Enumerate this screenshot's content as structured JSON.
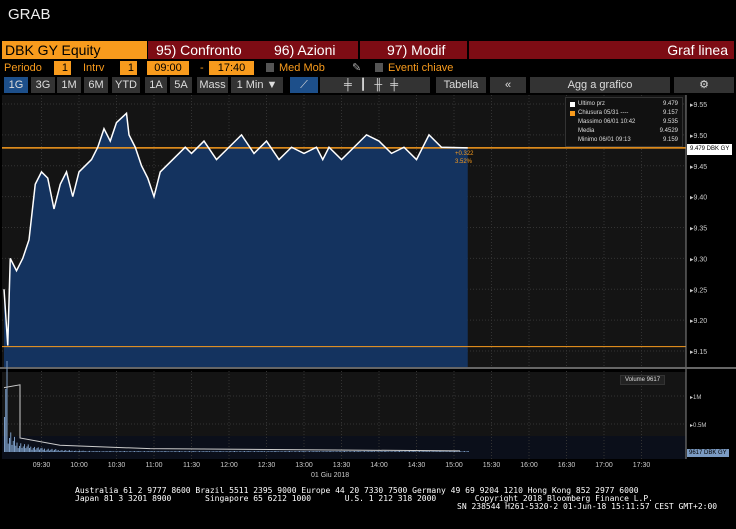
{
  "title": "GRAB",
  "header": {
    "ticker": "DBK GY Equity",
    "compare": "95) Confronto",
    "actions": "96) Azioni",
    "modify": "97) Modif",
    "chart_type": "Graf linea"
  },
  "controls": {
    "period_label": "Periodo",
    "period": "1",
    "interval_label": "Intrv",
    "interval": "1",
    "start": "09:00",
    "dash": "-",
    "end": "17:40",
    "moving_avg": "Med Mob",
    "key_events": "Eventi chiave"
  },
  "toolbar": {
    "ranges": [
      "1G",
      "3G",
      "1M",
      "6M",
      "YTD",
      "1A",
      "5A",
      "Mass"
    ],
    "freq": "1 Min ▼",
    "table": "Tabella",
    "back": "«",
    "add": "Agg a grafico",
    "settings": "⚙"
  },
  "legend": [
    {
      "label": "Ultimo prz",
      "value": "9.479"
    },
    {
      "label": "Chiusura 05/31 ----",
      "value": "9.157"
    },
    {
      "label": "Massimo 06/01 10:42",
      "value": "9.535"
    },
    {
      "label": "Media",
      "value": "9.4529"
    },
    {
      "label": "Minimo 06/01 09:13",
      "value": "9.159"
    }
  ],
  "change": {
    "abs": "+0.322",
    "pct": "3.52%"
  },
  "last_tag": "9.479 DBK GY",
  "volume": {
    "legend": "Volume 9617",
    "tag": "9617 DBK GY"
  },
  "date_label": "01 Giu 2018",
  "footer": {
    "line1": "Australia 61 2 9777 8600 Brazil 5511 2395 9000 Europe 44 20 7330 7500 Germany 49 69 9204 1210 Hong Kong 852 2977 6000",
    "line2": "Japan 81 3 3201 8900       Singapore 65 6212 1000       U.S. 1 212 318 2000        Copyright 2018 Bloomberg Finance L.P.",
    "line3": "SN 238544 H261-5320-2 01-Jun-18 15:11:57 CEST GMT+2:00"
  },
  "chart_data": {
    "type": "line",
    "ylim": [
      9.13,
      9.57
    ],
    "y_ticks": [
      "9.55",
      "9.50",
      "9.45",
      "9.40",
      "9.35",
      "9.30",
      "9.25",
      "9.20",
      "9.15"
    ],
    "x_ticks": [
      "09:30",
      "10:00",
      "10:30",
      "11:00",
      "11:30",
      "12:00",
      "12:30",
      "13:00",
      "13:30",
      "14:00",
      "14:30",
      "15:00",
      "15:30",
      "16:00",
      "16:30",
      "17:00",
      "17:30"
    ],
    "vol_ticks": [
      "1M",
      "0.5M"
    ],
    "prev_close": 9.157,
    "last": 9.479,
    "series": [
      [
        0,
        9.25
      ],
      [
        3,
        9.159
      ],
      [
        5,
        9.3
      ],
      [
        10,
        9.28
      ],
      [
        15,
        9.3
      ],
      [
        20,
        9.33
      ],
      [
        25,
        9.42
      ],
      [
        30,
        9.44
      ],
      [
        35,
        9.43
      ],
      [
        40,
        9.38
      ],
      [
        45,
        9.42
      ],
      [
        50,
        9.44
      ],
      [
        55,
        9.4
      ],
      [
        60,
        9.44
      ],
      [
        70,
        9.46
      ],
      [
        75,
        9.48
      ],
      [
        80,
        9.51
      ],
      [
        85,
        9.49
      ],
      [
        90,
        9.52
      ],
      [
        98,
        9.535
      ],
      [
        100,
        9.5
      ],
      [
        105,
        9.48
      ],
      [
        110,
        9.45
      ],
      [
        115,
        9.43
      ],
      [
        120,
        9.4
      ],
      [
        125,
        9.44
      ],
      [
        135,
        9.46
      ],
      [
        145,
        9.48
      ],
      [
        150,
        9.47
      ],
      [
        160,
        9.49
      ],
      [
        170,
        9.46
      ],
      [
        180,
        9.48
      ],
      [
        190,
        9.5
      ],
      [
        200,
        9.47
      ],
      [
        210,
        9.49
      ],
      [
        220,
        9.46
      ],
      [
        230,
        9.48
      ],
      [
        240,
        9.47
      ],
      [
        250,
        9.48
      ],
      [
        255,
        9.46
      ],
      [
        260,
        9.48
      ],
      [
        270,
        9.46
      ],
      [
        280,
        9.48
      ],
      [
        290,
        9.5
      ],
      [
        300,
        9.49
      ],
      [
        310,
        9.47
      ],
      [
        320,
        9.48
      ],
      [
        330,
        9.46
      ],
      [
        340,
        9.5
      ],
      [
        350,
        9.48
      ],
      [
        371,
        9.479
      ]
    ],
    "volume_k": [
      1250,
      250,
      180,
      140,
      120,
      100,
      90,
      80,
      70,
      60,
      50,
      45,
      40,
      35,
      30,
      28,
      25,
      22,
      20,
      18,
      18,
      15,
      15,
      12,
      12
    ]
  }
}
